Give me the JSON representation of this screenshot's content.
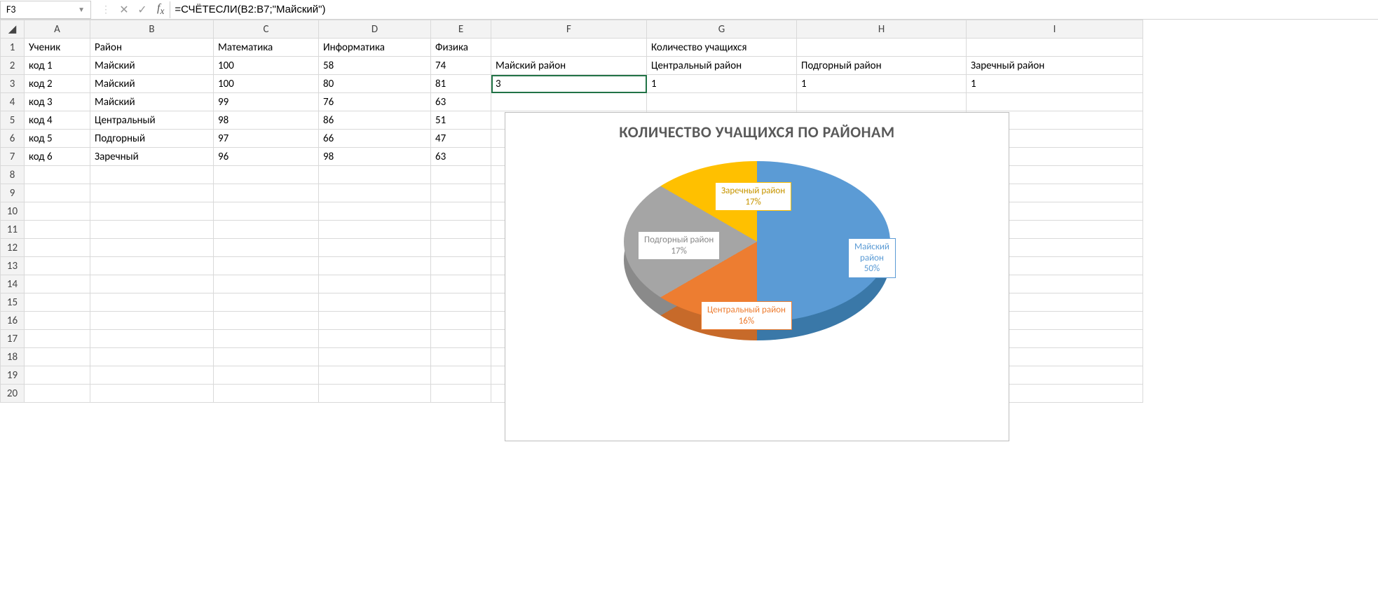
{
  "formula_bar": {
    "cell_ref": "F3",
    "formula": "=СЧЁТЕСЛИ(B2:B7;\"Майский\")"
  },
  "columns": [
    "A",
    "B",
    "C",
    "D",
    "E",
    "F",
    "G",
    "H",
    "I"
  ],
  "row_headers": [
    "1",
    "2",
    "3",
    "4",
    "5",
    "6",
    "7",
    "8",
    "9",
    "10",
    "11",
    "12",
    "13",
    "14",
    "15",
    "16",
    "17",
    "18",
    "19",
    "20"
  ],
  "selected_row": "3",
  "selected_col": "F",
  "cells": {
    "A1": "Ученик",
    "B1": "Район",
    "C1": "Математика",
    "D1": "Информатика",
    "E1": "Физика",
    "G1": "Количество учащихся",
    "A2": "код 1",
    "B2": "Майский",
    "C2": "100",
    "D2": "58",
    "E2": "74",
    "F2": "Майский район",
    "G2": "Центральный район",
    "H2": "Подгорный район",
    "I2": "Заречный район",
    "A3": "код 2",
    "B3": "Майский",
    "C3": "100",
    "D3": "80",
    "E3": "81",
    "F3": "3",
    "G3": "1",
    "H3": "1",
    "I3": "1",
    "A4": "код 3",
    "B4": "Майский",
    "C4": "99",
    "D4": "76",
    "E4": "63",
    "A5": "код 4",
    "B5": "Центральный",
    "C5": "98",
    "D5": "86",
    "E5": "51",
    "A6": "код 5",
    "B6": "Подгорный",
    "C6": "97",
    "D6": "66",
    "E6": "47",
    "A7": "код 6",
    "B7": "Заречный",
    "C7": "96",
    "D7": "98",
    "E7": "63"
  },
  "chart_data": {
    "type": "pie",
    "title": "КОЛИЧЕСТВО УЧАЩИХСЯ ПО РАЙОНАМ",
    "series": [
      {
        "name": "Майский район",
        "value": 3,
        "percent": "50%",
        "color": "#5b9bd5"
      },
      {
        "name": "Центральный район",
        "value": 1,
        "percent": "16%",
        "color": "#ed7d31"
      },
      {
        "name": "Подгорный район",
        "value": 1,
        "percent": "17%",
        "color": "#a5a5a5"
      },
      {
        "name": "Заречный район",
        "value": 1,
        "percent": "17%",
        "color": "#ffc000"
      }
    ]
  }
}
